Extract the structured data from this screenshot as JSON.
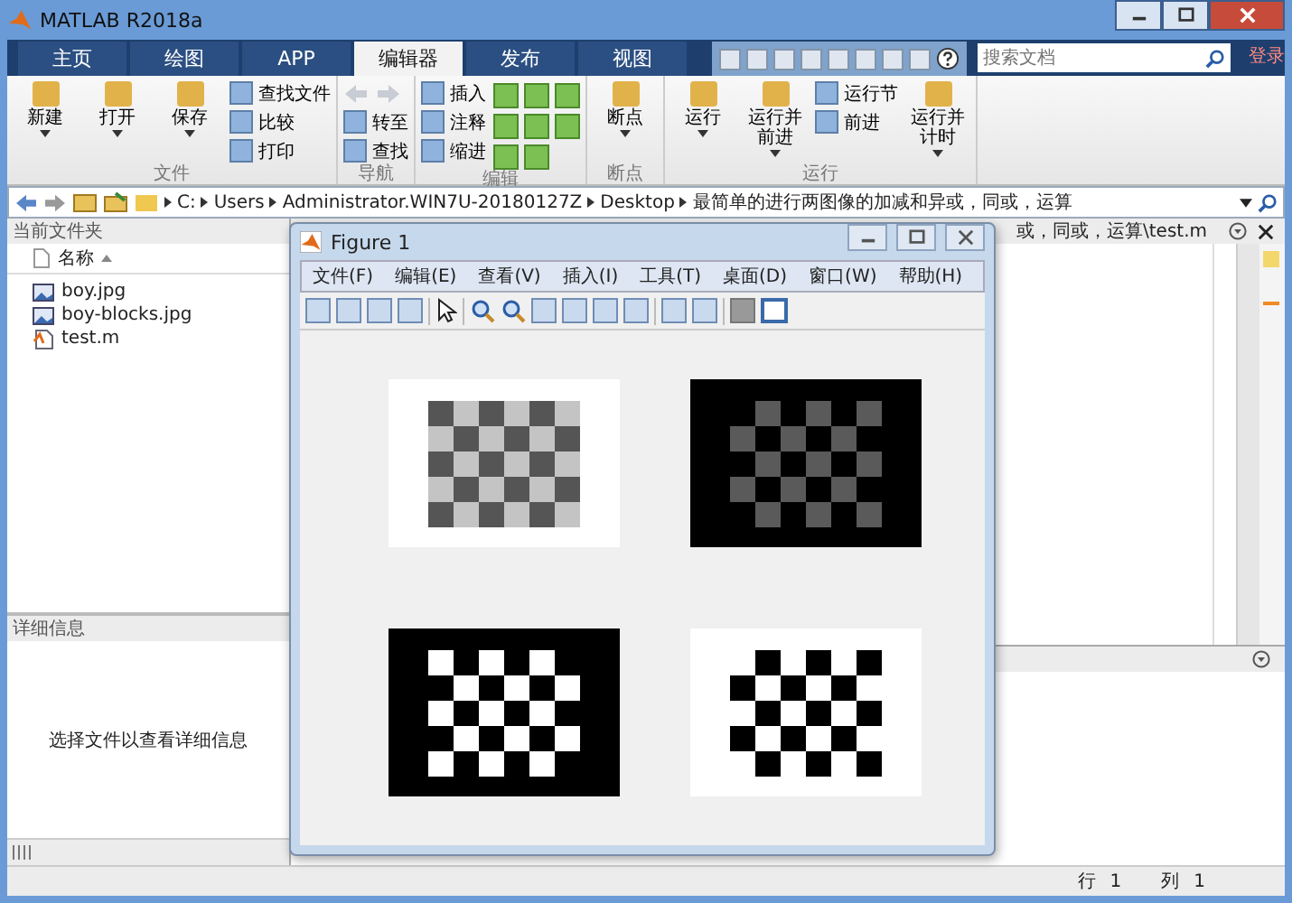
{
  "window": {
    "title": "MATLAB R2018a"
  },
  "tabs": [
    {
      "label": "主页",
      "selected": false
    },
    {
      "label": "绘图",
      "selected": false
    },
    {
      "label": "APP",
      "selected": false
    },
    {
      "label": "编辑器",
      "selected": true
    },
    {
      "label": "发布",
      "selected": false
    },
    {
      "label": "视图",
      "selected": false
    }
  ],
  "search": {
    "placeholder": "搜索文档"
  },
  "login": "登录",
  "ribbon": {
    "groups": [
      {
        "label": "文件",
        "items": [
          {
            "kind": "large",
            "label": "新建"
          },
          {
            "kind": "large",
            "label": "打开"
          },
          {
            "kind": "large",
            "label": "保存"
          },
          {
            "kind": "small",
            "labels": [
              "查找文件",
              "比较",
              "打印"
            ]
          }
        ]
      },
      {
        "label": "导航",
        "items": [
          {
            "kind": "nav",
            "labels": [
              "转至",
              "查找"
            ]
          }
        ]
      },
      {
        "label": "编辑",
        "items": [
          {
            "kind": "small",
            "labels": [
              "插入",
              "注释",
              "缩进"
            ]
          },
          {
            "kind": "grid"
          }
        ]
      },
      {
        "label": "断点",
        "items": [
          {
            "kind": "large",
            "label": "断点"
          }
        ]
      },
      {
        "label": "运行",
        "items": [
          {
            "kind": "large",
            "label": "运行"
          },
          {
            "kind": "large",
            "label": "运行并前进"
          },
          {
            "kind": "small",
            "labels": [
              "运行节",
              "前进"
            ]
          },
          {
            "kind": "large",
            "label": "运行并计时"
          }
        ]
      }
    ]
  },
  "address": {
    "segments": [
      "C:",
      "Users",
      "Administrator.WIN7U-20180127Z",
      "Desktop",
      "最简单的进行两图像的加减和异或，同或，运算"
    ]
  },
  "current_folder": {
    "title": "当前文件夹",
    "column": "名称",
    "files": [
      {
        "name": "boy.jpg",
        "kind": "image"
      },
      {
        "name": "boy-blocks.jpg",
        "kind": "image"
      },
      {
        "name": "test.m",
        "kind": "script"
      }
    ]
  },
  "details": {
    "title": "详细信息",
    "message": "选择文件以查看详细信息"
  },
  "editor": {
    "title": "或，同或，运算\\test.m"
  },
  "figure": {
    "title": "Figure 1",
    "menus": [
      "文件(F)",
      "编辑(E)",
      "查看(V)",
      "插入(I)",
      "工具(T)",
      "桌面(D)",
      "窗口(W)",
      "帮助(H)"
    ],
    "panels": [
      {
        "kind": "photo",
        "inverted": false
      },
      {
        "kind": "photo",
        "inverted": true
      },
      {
        "kind": "binary",
        "inverted": true
      },
      {
        "kind": "binary",
        "inverted": false
      }
    ]
  },
  "status_bar": {
    "row_label": "行",
    "row": "1",
    "col_label": "列",
    "col": "1"
  }
}
